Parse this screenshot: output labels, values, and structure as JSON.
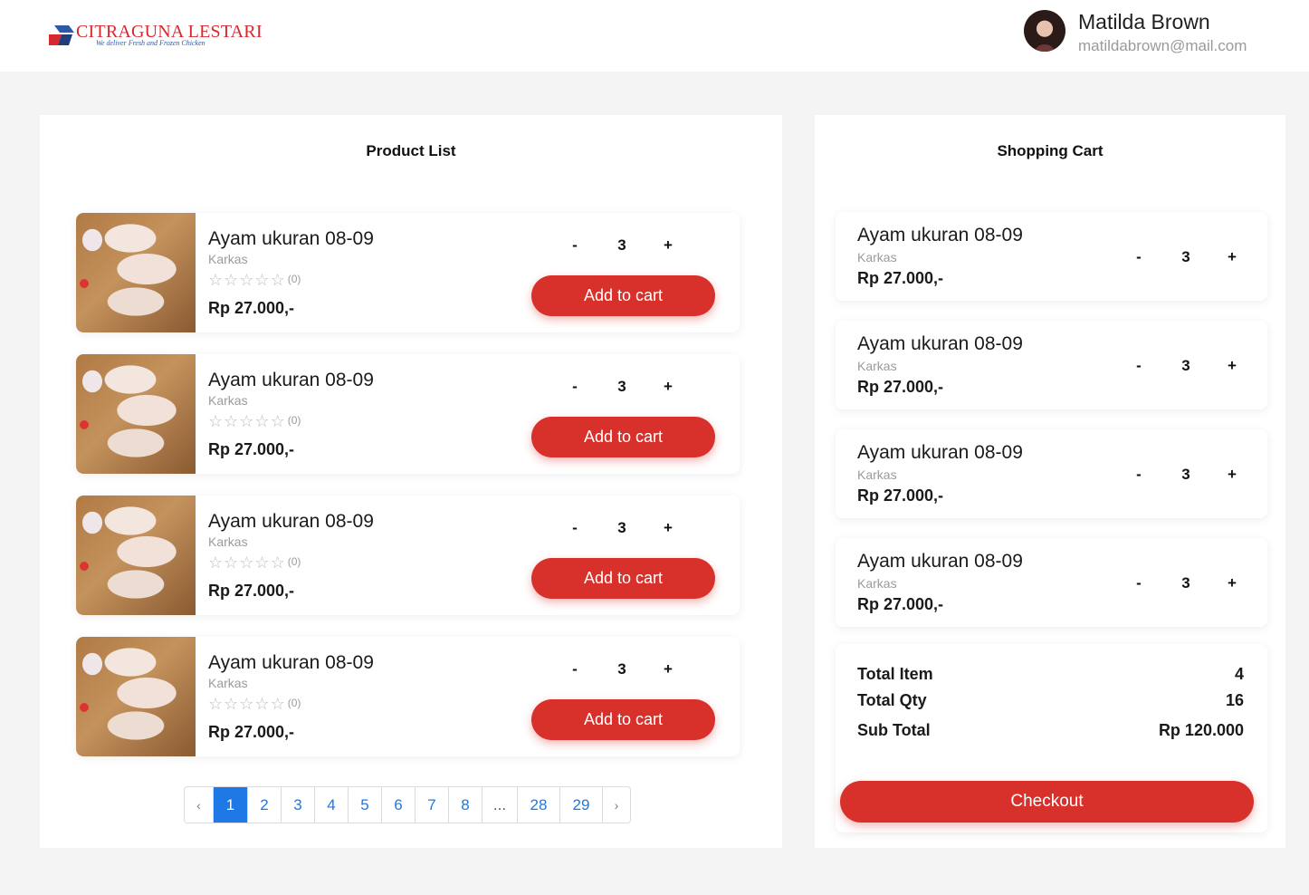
{
  "brand": {
    "name": "CITRAGUNA LESTARI",
    "tagline": "We deliver Fresh and Frozen Chicken"
  },
  "user": {
    "name": "Matilda Brown",
    "email": "matildabrown@mail.com"
  },
  "product_panel": {
    "title": "Product List",
    "products": [
      {
        "name": "Ayam ukuran 08-09",
        "category": "Karkas",
        "rating_count": "(0)",
        "price": "Rp 27.000,-",
        "qty": "3",
        "minus": "-",
        "plus": "+",
        "button": "Add to cart"
      },
      {
        "name": "Ayam ukuran 08-09",
        "category": "Karkas",
        "rating_count": "(0)",
        "price": "Rp 27.000,-",
        "qty": "3",
        "minus": "-",
        "plus": "+",
        "button": "Add to cart"
      },
      {
        "name": "Ayam ukuran 08-09",
        "category": "Karkas",
        "rating_count": "(0)",
        "price": "Rp 27.000,-",
        "qty": "3",
        "minus": "-",
        "plus": "+",
        "button": "Add to cart"
      },
      {
        "name": "Ayam ukuran 08-09",
        "category": "Karkas",
        "rating_count": "(0)",
        "price": "Rp 27.000,-",
        "qty": "3",
        "minus": "-",
        "plus": "+",
        "button": "Add to cart"
      }
    ],
    "pagination": {
      "prev": "‹",
      "pages": [
        "1",
        "2",
        "3",
        "4",
        "5",
        "6",
        "7",
        "8",
        "...",
        "28",
        "29"
      ],
      "active": "1",
      "next": "›"
    }
  },
  "cart_panel": {
    "title": "Shopping Cart",
    "items": [
      {
        "name": "Ayam ukuran 08-09",
        "category": "Karkas",
        "price": "Rp 27.000,-",
        "qty": "3",
        "minus": "-",
        "plus": "+"
      },
      {
        "name": "Ayam ukuran 08-09",
        "category": "Karkas",
        "price": "Rp 27.000,-",
        "qty": "3",
        "minus": "-",
        "plus": "+"
      },
      {
        "name": "Ayam ukuran 08-09",
        "category": "Karkas",
        "price": "Rp 27.000,-",
        "qty": "3",
        "minus": "-",
        "plus": "+"
      },
      {
        "name": "Ayam ukuran 08-09",
        "category": "Karkas",
        "price": "Rp 27.000,-",
        "qty": "3",
        "minus": "-",
        "plus": "+"
      }
    ],
    "summary": {
      "total_item_label": "Total Item",
      "total_item_value": "4",
      "total_qty_label": "Total Qty",
      "total_qty_value": "16",
      "sub_total_label": "Sub Total",
      "sub_total_value": "Rp 120.000"
    },
    "checkout_label": "Checkout"
  },
  "colors": {
    "accent_red": "#d8302b",
    "link_blue": "#1e78e6",
    "page_bg": "#f4f4f4"
  },
  "icons": {
    "star": "☆"
  }
}
